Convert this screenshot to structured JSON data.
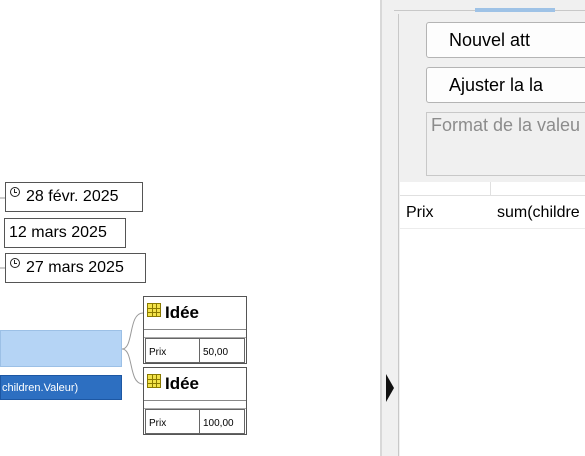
{
  "mindmap": {
    "dates": [
      "28 févr. 2025",
      "12 mars 2025",
      "27 mars 2025"
    ],
    "root_formula": "children.Valeur)",
    "ideas": [
      {
        "title": "Idée",
        "attr_name": "Prix",
        "attr_value": "50,00"
      },
      {
        "title": "Idée",
        "attr_name": "Prix",
        "attr_value": "100,00"
      }
    ]
  },
  "panel": {
    "new_attribute_button": "Nouvel att",
    "adjust_button": "Ajuster la la",
    "format_placeholder": "Format de la valeu",
    "attributes": [
      {
        "name": "Prix",
        "value": "sum(childre"
      }
    ]
  },
  "colors": {
    "root_fill": "#b5d4f5",
    "formula_bar": "#2d6fc1",
    "idea_icon": "#f2e24a",
    "panel_bg": "#f0f0f0"
  }
}
